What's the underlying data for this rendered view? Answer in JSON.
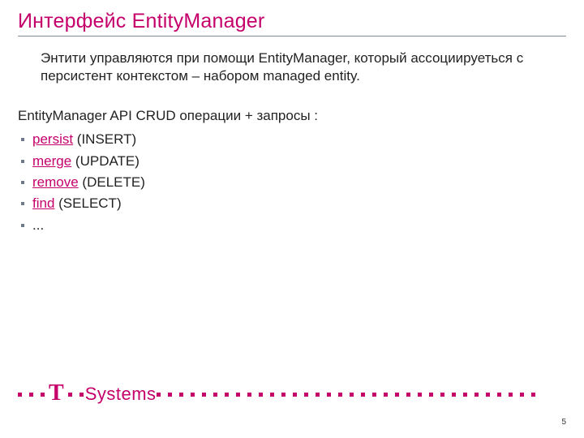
{
  "title": "Интерфейс EntityManager",
  "intro": "Энтити управляются при помощи EntityManager, который  ассоциируеться с персистент контекстом – набором  managed entity.",
  "subhead": "EntityManager API   CRUD операции + запросы :",
  "bullets": [
    {
      "link": "persist",
      "suffix": " (INSERT)"
    },
    {
      "link": "merge",
      "suffix": " (UPDATE)"
    },
    {
      "link": "remove",
      "suffix": " (DELETE)"
    },
    {
      "link": "find",
      "suffix": " (SELECT)"
    },
    {
      "link": "",
      "suffix": "..."
    }
  ],
  "logo": {
    "t": "T",
    "systems": "Systems"
  },
  "page_number": "5",
  "colors": {
    "accent": "#c5006b",
    "rule": "#7a8b9d"
  }
}
